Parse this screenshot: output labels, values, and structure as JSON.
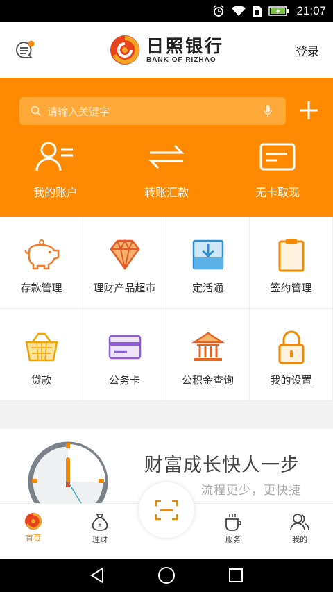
{
  "status_bar": {
    "time": "21:07",
    "icons": [
      "alarm-icon",
      "wifi-icon",
      "sim-icon",
      "battery-charging-icon"
    ]
  },
  "header": {
    "logo_cn": "日照银行",
    "logo_en": "BANK OF RIZHAO",
    "login_label": "登录",
    "brand_color": "#e8431f"
  },
  "banner": {
    "accent": "#ff8a00",
    "search_placeholder": "请输入关键字",
    "quick_actions": [
      {
        "label": "我的账户",
        "icon": "account-icon"
      },
      {
        "label": "转账汇款",
        "icon": "transfer-icon"
      },
      {
        "label": "无卡取现",
        "icon": "cardless-cash-icon"
      }
    ]
  },
  "grid": [
    {
      "label": "存款管理",
      "icon": "piggy-bank-icon"
    },
    {
      "label": "理财产品超市",
      "icon": "diamond-icon"
    },
    {
      "label": "定活通",
      "icon": "tray-download-icon"
    },
    {
      "label": "签约管理",
      "icon": "clipboard-icon"
    },
    {
      "label": "贷款",
      "icon": "basket-icon"
    },
    {
      "label": "公务卡",
      "icon": "card-icon"
    },
    {
      "label": "公积金查询",
      "icon": "bank-building-icon"
    },
    {
      "label": "我的设置",
      "icon": "lock-icon"
    }
  ],
  "promo": {
    "title": "财富成长快人一步",
    "subtitle": "流程更少，更快捷"
  },
  "tabs": [
    {
      "label": "首页",
      "icon": "home-logo-icon",
      "active": true
    },
    {
      "label": "理财",
      "icon": "money-bag-icon",
      "active": false
    },
    {
      "label": "服务",
      "icon": "cup-icon",
      "active": false
    },
    {
      "label": "我的",
      "icon": "user-icon",
      "active": false
    }
  ]
}
